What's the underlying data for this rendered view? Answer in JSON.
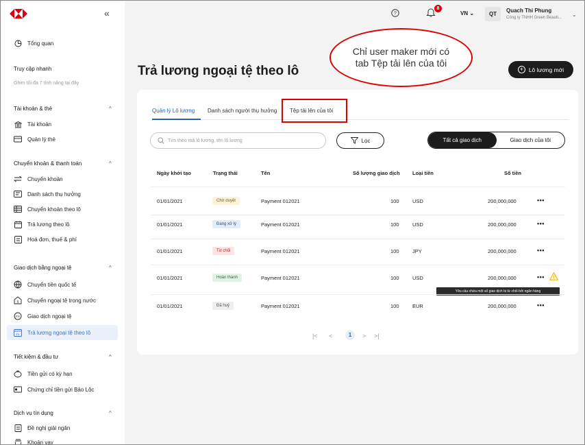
{
  "sidebar": {
    "overview": "Tổng quan",
    "quick_access": {
      "title": "Truy cập nhanh",
      "hint": "Ghim tối đa 7 tính năng tại đây"
    },
    "sections": [
      {
        "title": "Tài khoản & thẻ",
        "items": [
          "Tài khoản",
          "Quản lý thẻ"
        ]
      },
      {
        "title": "Chuyển khoản & thanh toán",
        "items": [
          "Chuyển khoản",
          "Danh sách thụ hưởng",
          "Chuyển khoản theo lô",
          "Trả lương theo lô",
          "Hoá đơn, thuế & phí"
        ]
      },
      {
        "title": "Giao dịch bằng ngoại tệ",
        "items": [
          "Chuyển tiền quốc tế",
          "Chuyển ngoại tệ trong nước",
          "Giao dịch ngoại tệ",
          "Trả lương ngoại tệ theo lô"
        ]
      },
      {
        "title": "Tiết kiệm & đầu tư",
        "items": [
          "Tiền gửi có kỳ hạn",
          "Chứng chỉ tiền gửi Bảo Lộc"
        ]
      },
      {
        "title": "Dịch vụ tín dụng",
        "items": [
          "Đề nghị giải ngân",
          "Khoản vay"
        ]
      }
    ],
    "collapse_icon": "«",
    "caret": "^"
  },
  "header": {
    "notification_count": "8",
    "language": "VN ⌄",
    "avatar_initials": "QT",
    "user_name": "Quach Thi Phung",
    "company": "Công ty TNHH Green Beauti...",
    "user_caret": "⌄"
  },
  "page": {
    "title": "Trả lương ngoại tệ theo lô",
    "new_batch_button": "Lô lương mới"
  },
  "annotation": {
    "text": "Chỉ user maker mới có tab Tệp tải lên của tôi",
    "color": "#e10000"
  },
  "tabs": [
    "Quản lý Lô lương",
    "Danh sách người thụ hưởng",
    "Tệp tải lên của tôi"
  ],
  "toolbar": {
    "search_placeholder": "Tìm theo mã lô lương, tên lô lương",
    "filter_label": "Lọc",
    "segment_all": "Tất cả giao dịch",
    "segment_mine": "Giao dịch của tôi"
  },
  "table": {
    "headers": [
      "Ngày khởi tạo",
      "Trạng thái",
      "Tên",
      "Số lượng giao dịch",
      "Loại tiền",
      "Số tiền"
    ],
    "rows": [
      {
        "date": "01/01/2021",
        "status": "Chờ duyệt",
        "name": "Payment 012021",
        "count": "100",
        "currency": "USD",
        "amount": "200,000,000",
        "more": "•••"
      },
      {
        "date": "01/01/2021",
        "status": "Đang xử lý",
        "name": "Payment 012021",
        "count": "100",
        "currency": "USD",
        "amount": "200,000,000",
        "more": "•••"
      },
      {
        "date": "01/01/2021",
        "status": "Từ chối",
        "name": "Payment 012021",
        "count": "100",
        "currency": "JPY",
        "amount": "200,000,000",
        "more": "•••"
      },
      {
        "date": "01/01/2021",
        "status": "Hoàn thành",
        "name": "Payment 012021",
        "count": "100",
        "currency": "USD",
        "amount": "200,000,000",
        "more": "•••"
      },
      {
        "date": "01/01/2021",
        "status": "Đã huỷ",
        "name": "Payment 012021",
        "count": "100",
        "currency": "EUR",
        "amount": "200,000,000",
        "more": "•••"
      }
    ],
    "tooltip": "Yêu cầu chứa một số giao dịch bị từ chối bởi ngân hàng"
  },
  "pagination": {
    "first": "|<",
    "prev": "<",
    "current": "1",
    "next": ">",
    "last": ">|"
  },
  "status_colors": {
    "pending": "#fdf3d8",
    "processing": "#e3ecfa",
    "rejected": "#fde4e4",
    "done": "#e2f3e6",
    "cancelled": "#eeeeee"
  }
}
